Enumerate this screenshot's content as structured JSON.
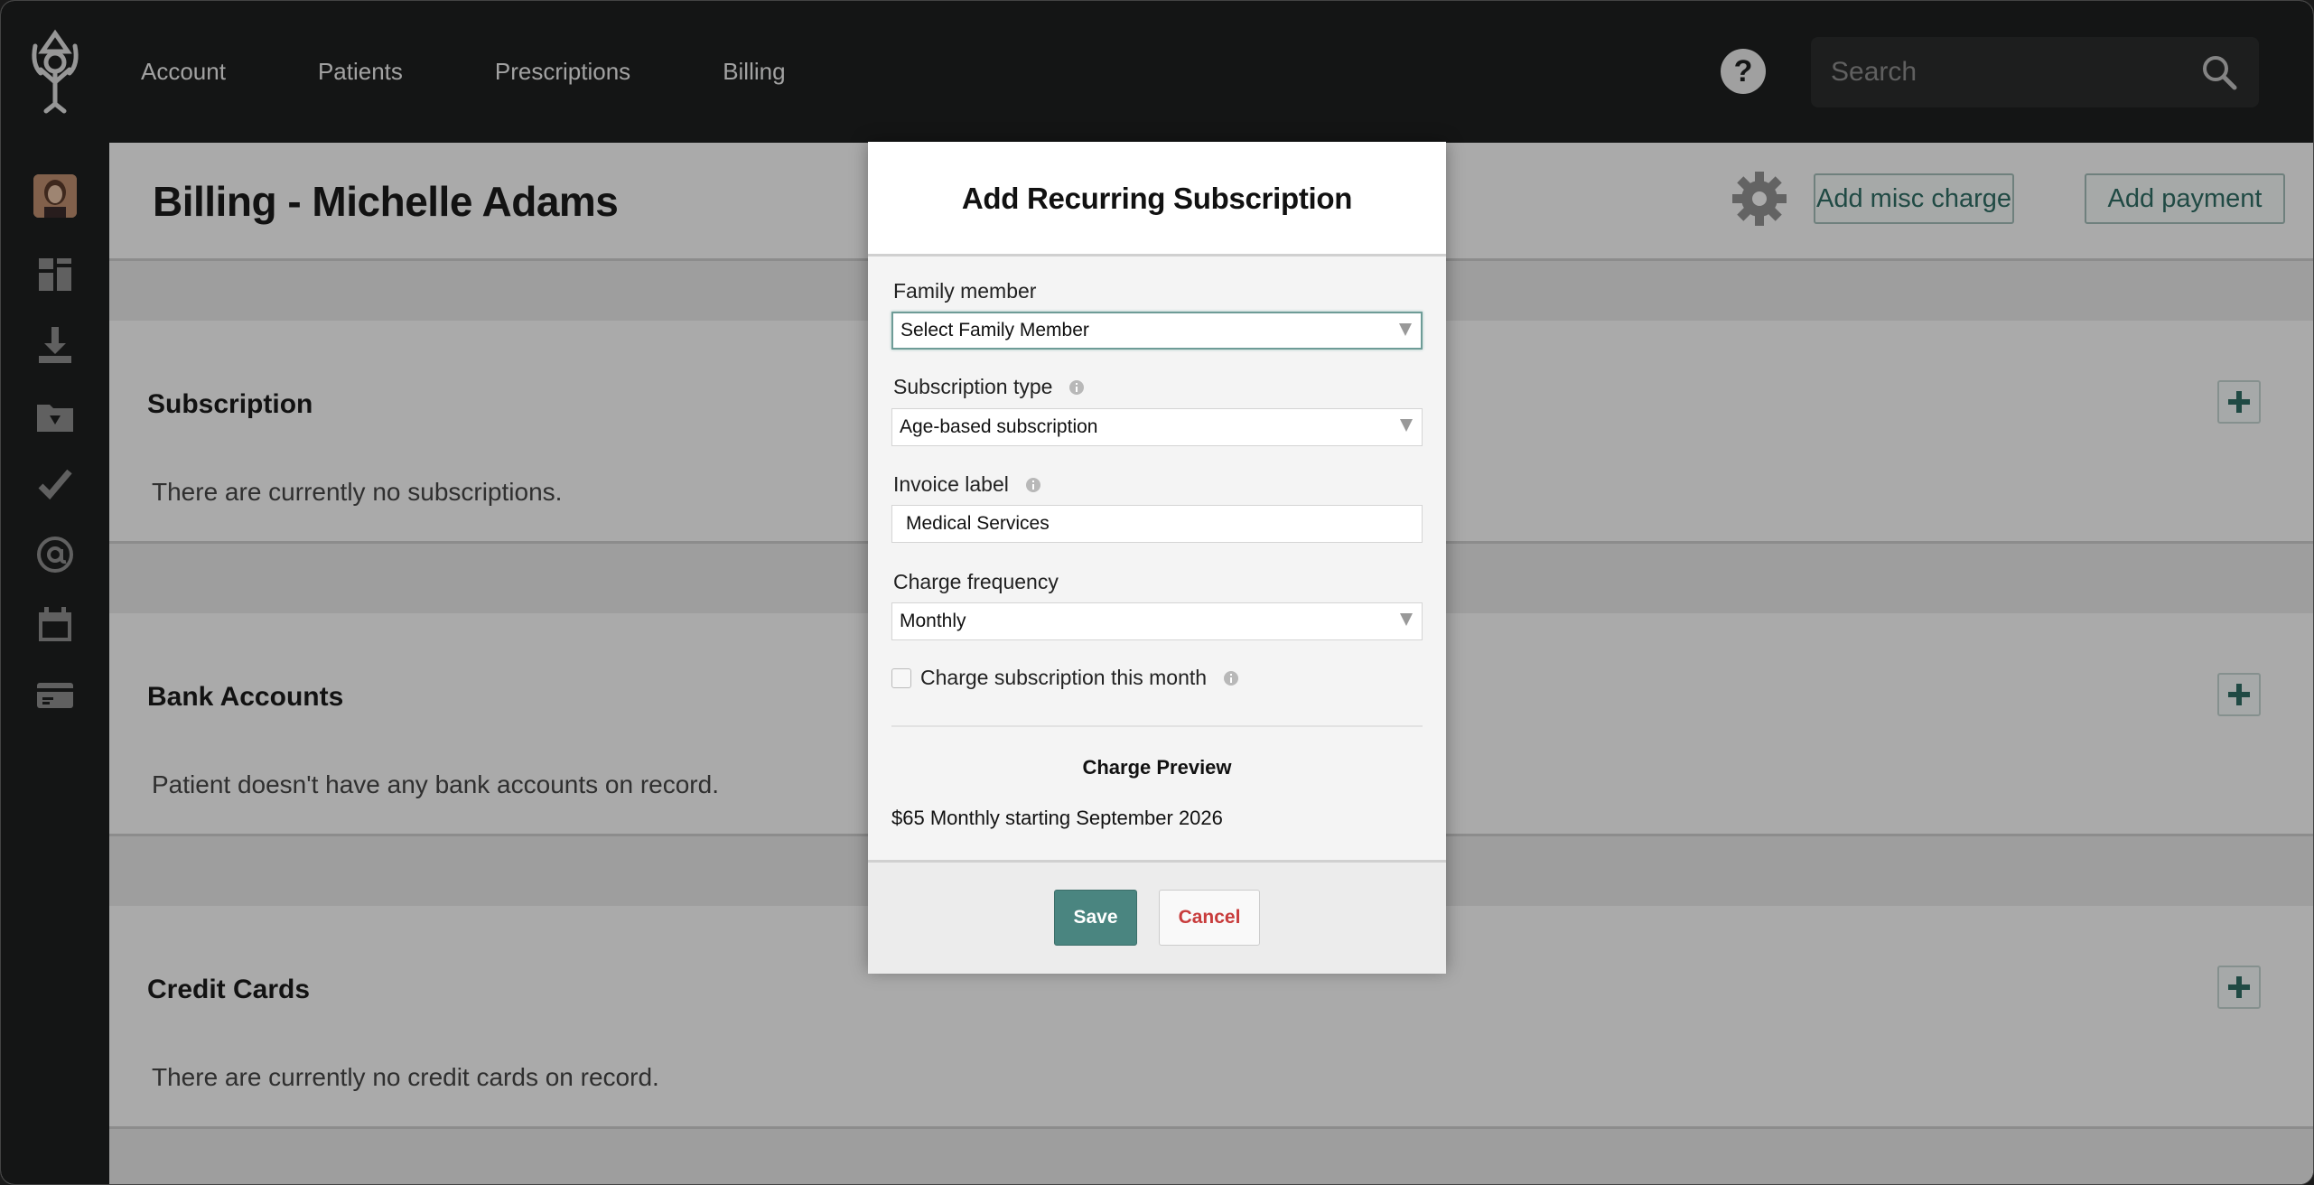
{
  "nav": {
    "items": [
      {
        "label": "Account"
      },
      {
        "label": "Patients"
      },
      {
        "label": "Prescriptions"
      },
      {
        "label": "Billing"
      }
    ],
    "help_label": "?",
    "search_placeholder": "Search"
  },
  "sidebar": {
    "icons": [
      "avatar",
      "dashboard-icon",
      "download-icon",
      "folder-download-icon",
      "checkmark-icon",
      "at-icon",
      "calendar-icon",
      "billing-card-icon"
    ]
  },
  "page": {
    "title": "Billing - Michelle Adams",
    "add_misc_charge_label": "Add misc charge",
    "add_payment_label": "Add payment"
  },
  "sections": [
    {
      "title": "Subscription",
      "text": "There are currently no subscriptions."
    },
    {
      "title": "Bank Accounts",
      "text": "Patient doesn't have any bank accounts on record."
    },
    {
      "title": "Credit Cards",
      "text": "There are currently no credit cards on record."
    }
  ],
  "modal": {
    "title": "Add Recurring Subscription",
    "family_member": {
      "label": "Family member",
      "value": "Select Family Member"
    },
    "subscription_type": {
      "label": "Subscription type",
      "value": "Age-based subscription"
    },
    "invoice_label": {
      "label": "Invoice label",
      "value": "Medical Services"
    },
    "charge_frequency": {
      "label": "Charge frequency",
      "value": "Monthly"
    },
    "charge_this_month": {
      "label": "Charge subscription this month",
      "checked": false
    },
    "preview_title": "Charge Preview",
    "preview_text": "$65 Monthly starting September 2026",
    "save_label": "Save",
    "cancel_label": "Cancel"
  },
  "colors": {
    "topbar": "#1d1f1f",
    "accent": "#4a8580",
    "cancel_text": "#c83c3c"
  }
}
